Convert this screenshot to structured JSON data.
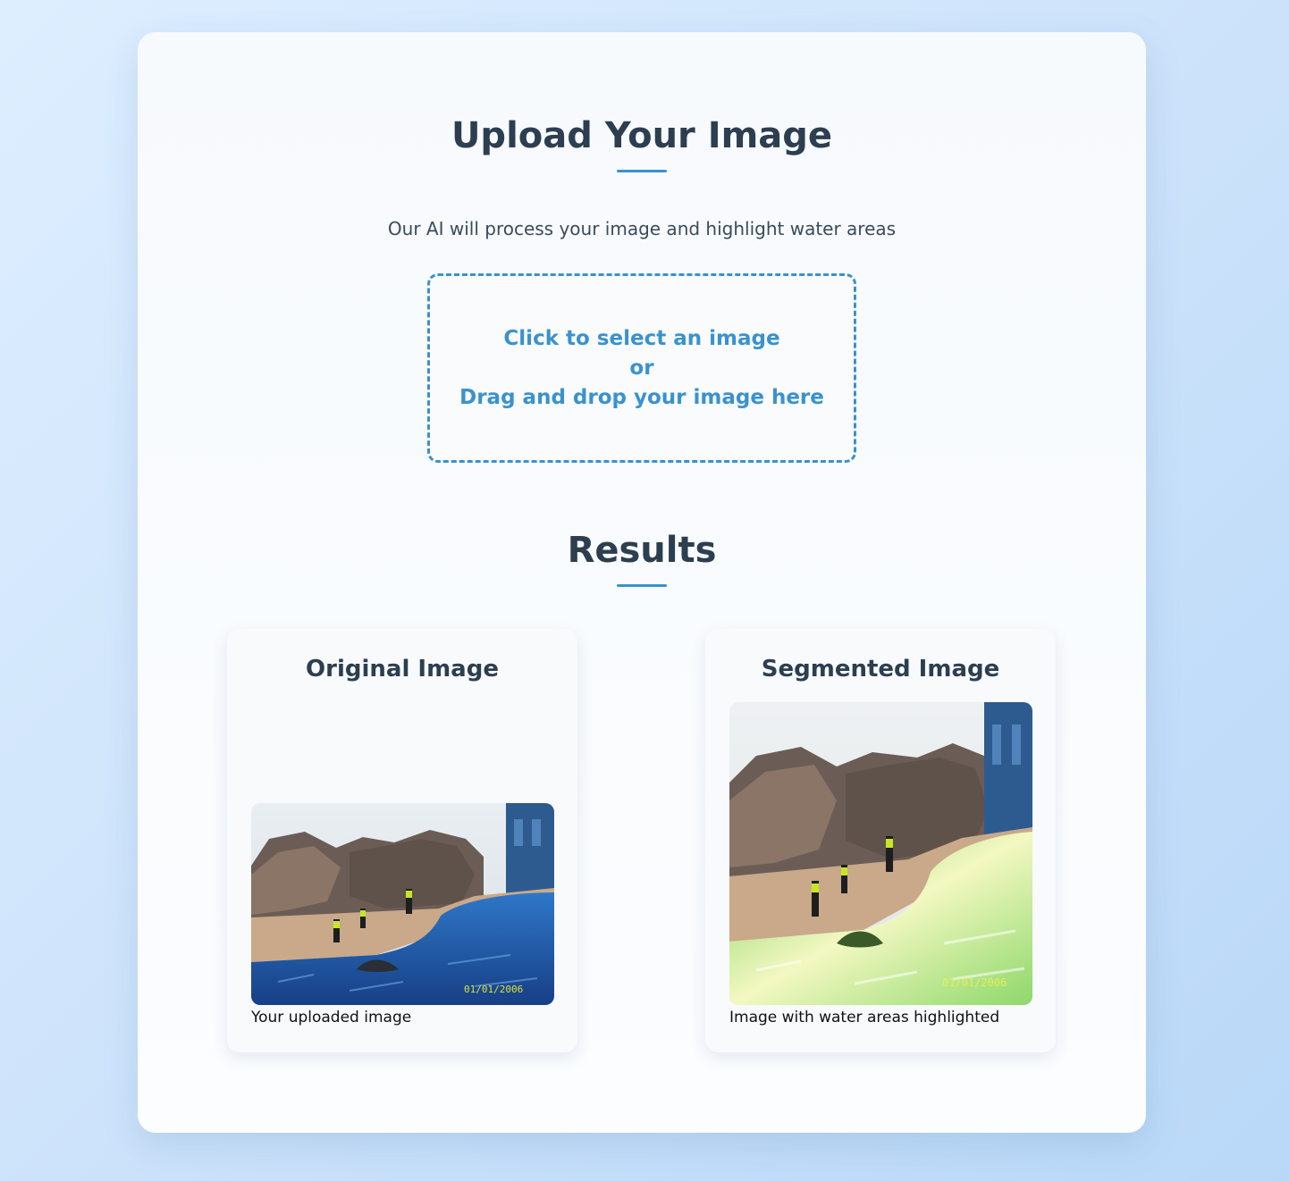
{
  "upload": {
    "title": "Upload Your Image",
    "subtitle": "Our AI will process your image and highlight water areas",
    "dropzone": {
      "line1": "Click to select an image",
      "line2": "or",
      "line3": "Drag and drop your image here"
    }
  },
  "results": {
    "title": "Results",
    "original": {
      "title": "Original Image",
      "caption": "Your uploaded image"
    },
    "segmented": {
      "title": "Segmented Image",
      "caption": "Image with water areas highlighted"
    }
  },
  "colors": {
    "accent": "#3a92cd",
    "heading": "#2c3e50",
    "water_original": "#1f5fae",
    "water_highlight": "#9ee070"
  }
}
